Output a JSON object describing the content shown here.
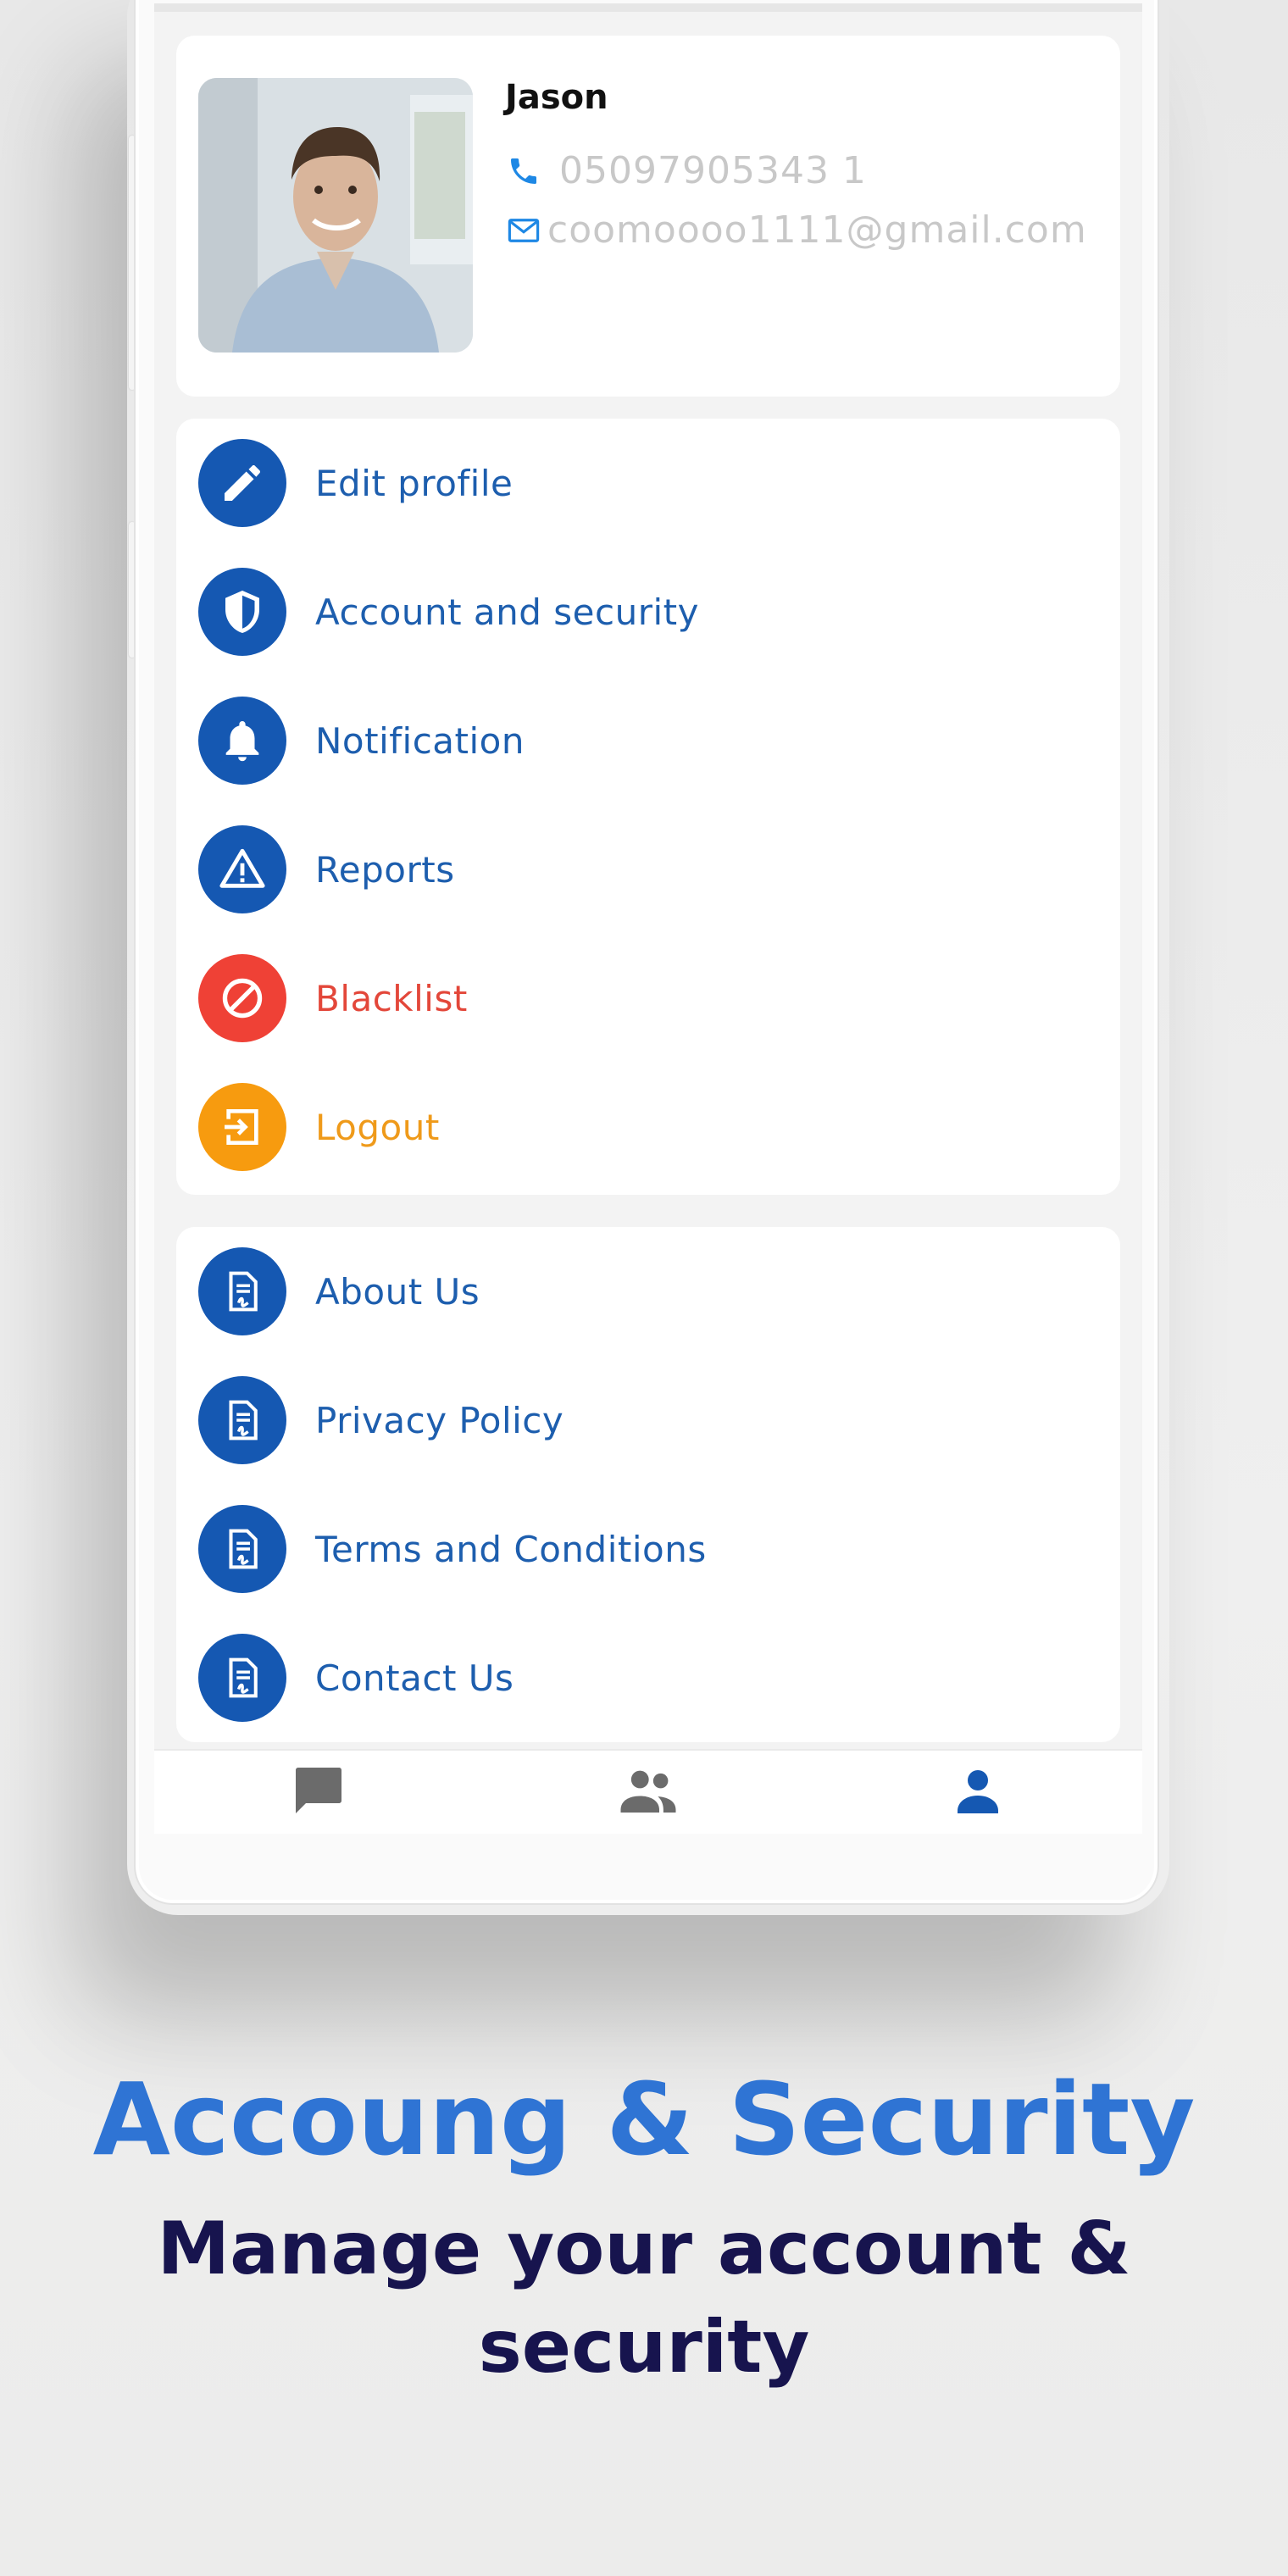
{
  "profile": {
    "name": "Jason",
    "phone": "05097905343 1",
    "email": "coomoooo1111@gmail.com"
  },
  "menu_primary": [
    {
      "label": "Edit profile",
      "icon": "pencil-icon",
      "tone": "blue"
    },
    {
      "label": "Account and security",
      "icon": "shield-icon",
      "tone": "blue"
    },
    {
      "label": "Notification",
      "icon": "bell-icon",
      "tone": "blue"
    },
    {
      "label": "Reports",
      "icon": "warning-icon",
      "tone": "blue"
    },
    {
      "label": "Blacklist",
      "icon": "block-icon",
      "tone": "red"
    },
    {
      "label": "Logout",
      "icon": "logout-icon",
      "tone": "orange"
    }
  ],
  "menu_info": [
    {
      "label": "About Us",
      "icon": "document-icon"
    },
    {
      "label": "Privacy Policy",
      "icon": "document-icon"
    },
    {
      "label": "Terms and Conditions",
      "icon": "document-icon"
    },
    {
      "label": "Contact Us",
      "icon": "document-icon"
    }
  ],
  "tabs": [
    {
      "icon": "chat-icon",
      "active": false
    },
    {
      "icon": "people-icon",
      "active": false
    },
    {
      "icon": "person-icon",
      "active": true
    }
  ],
  "promo": {
    "headline": "Accoung & Security",
    "subhead": "Manage your account & security"
  },
  "colors": {
    "primary_blue": "#1558b2",
    "label_blue": "#1d5eae",
    "danger_red": "#ef4136",
    "warning_orange": "#f79b0f",
    "headline_blue": "#2f74d4",
    "subhead_navy": "#17144e",
    "tab_inactive": "#6b6b6b"
  }
}
